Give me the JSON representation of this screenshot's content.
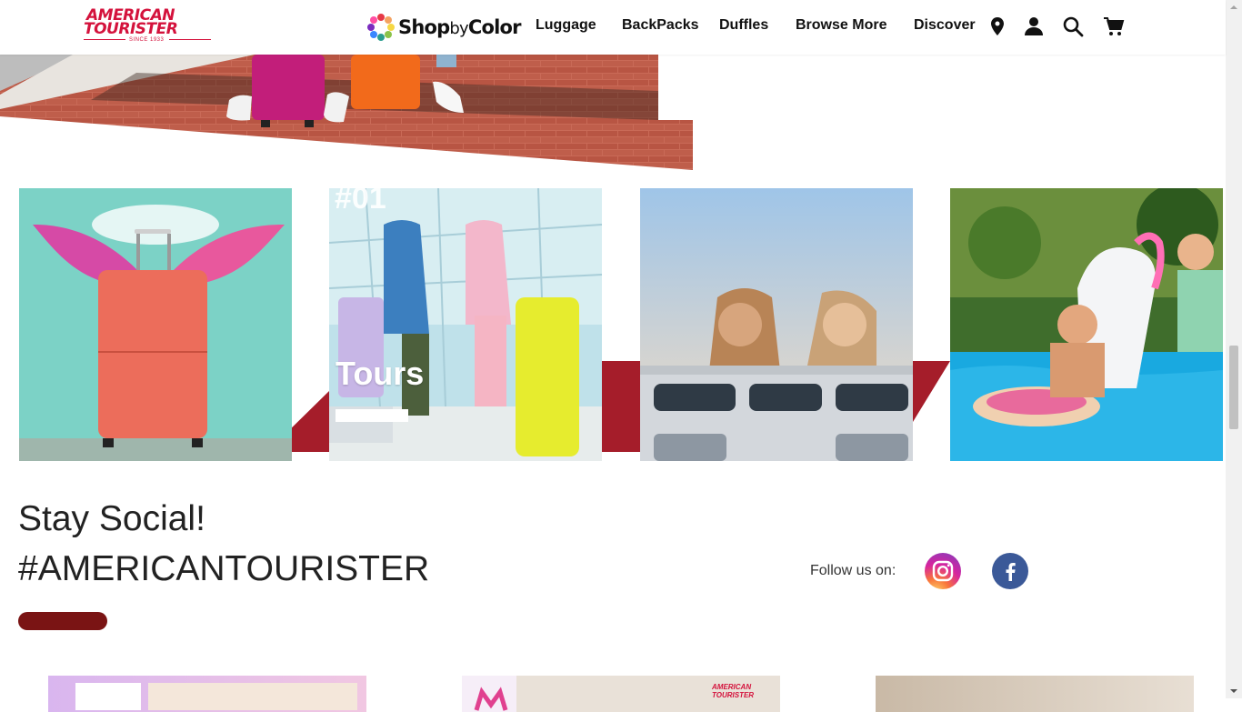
{
  "header": {
    "logo_line1": "AMERICAN",
    "logo_line2": "TOURISTER",
    "logo_since": "SINCE 1933",
    "shop_by_color": {
      "shop": "Shop",
      "by": "by",
      "color": "Color"
    },
    "nav": [
      "Luggage",
      "BackPacks",
      "Duffles",
      "Browse More",
      "Discover"
    ],
    "icons": [
      "location-pin-icon",
      "account-icon",
      "search-icon",
      "cart-icon"
    ]
  },
  "tiles": [
    {
      "id": "tile-1"
    },
    {
      "id": "tile-2",
      "number": "#01",
      "label": "Tours"
    },
    {
      "id": "tile-3"
    },
    {
      "id": "tile-4"
    }
  ],
  "social": {
    "title": "Stay Social!",
    "hashtag": "#AMERICANTOURISTER",
    "follow_label": "Follow us on:",
    "icons": [
      "instagram-icon",
      "facebook-icon"
    ]
  },
  "colors": {
    "brand_red": "#d4123c",
    "accent_red": "#a51d2a",
    "dark_red": "#7a1414",
    "facebook_blue": "#3b5998"
  }
}
